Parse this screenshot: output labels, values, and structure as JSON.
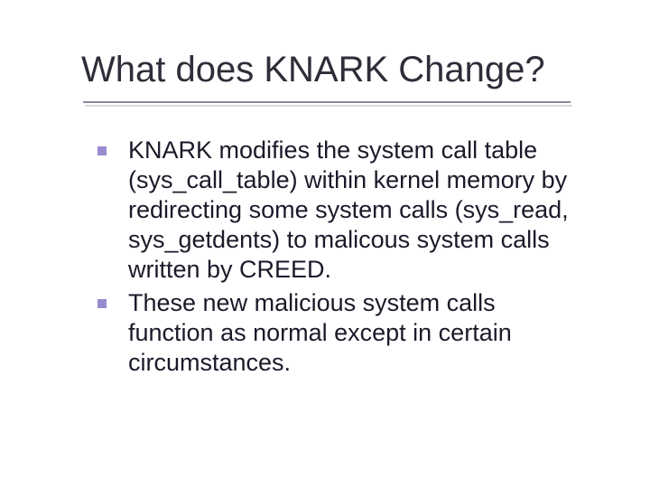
{
  "title": "What does KNARK Change?",
  "bullets": [
    "KNARK modifies the system call table (sys_call_table) within kernel memory by redirecting some system calls (sys_read, sys_getdents) to malicous system calls written by CREED.",
    "These new malicious system calls function as normal except in certain circumstances."
  ]
}
